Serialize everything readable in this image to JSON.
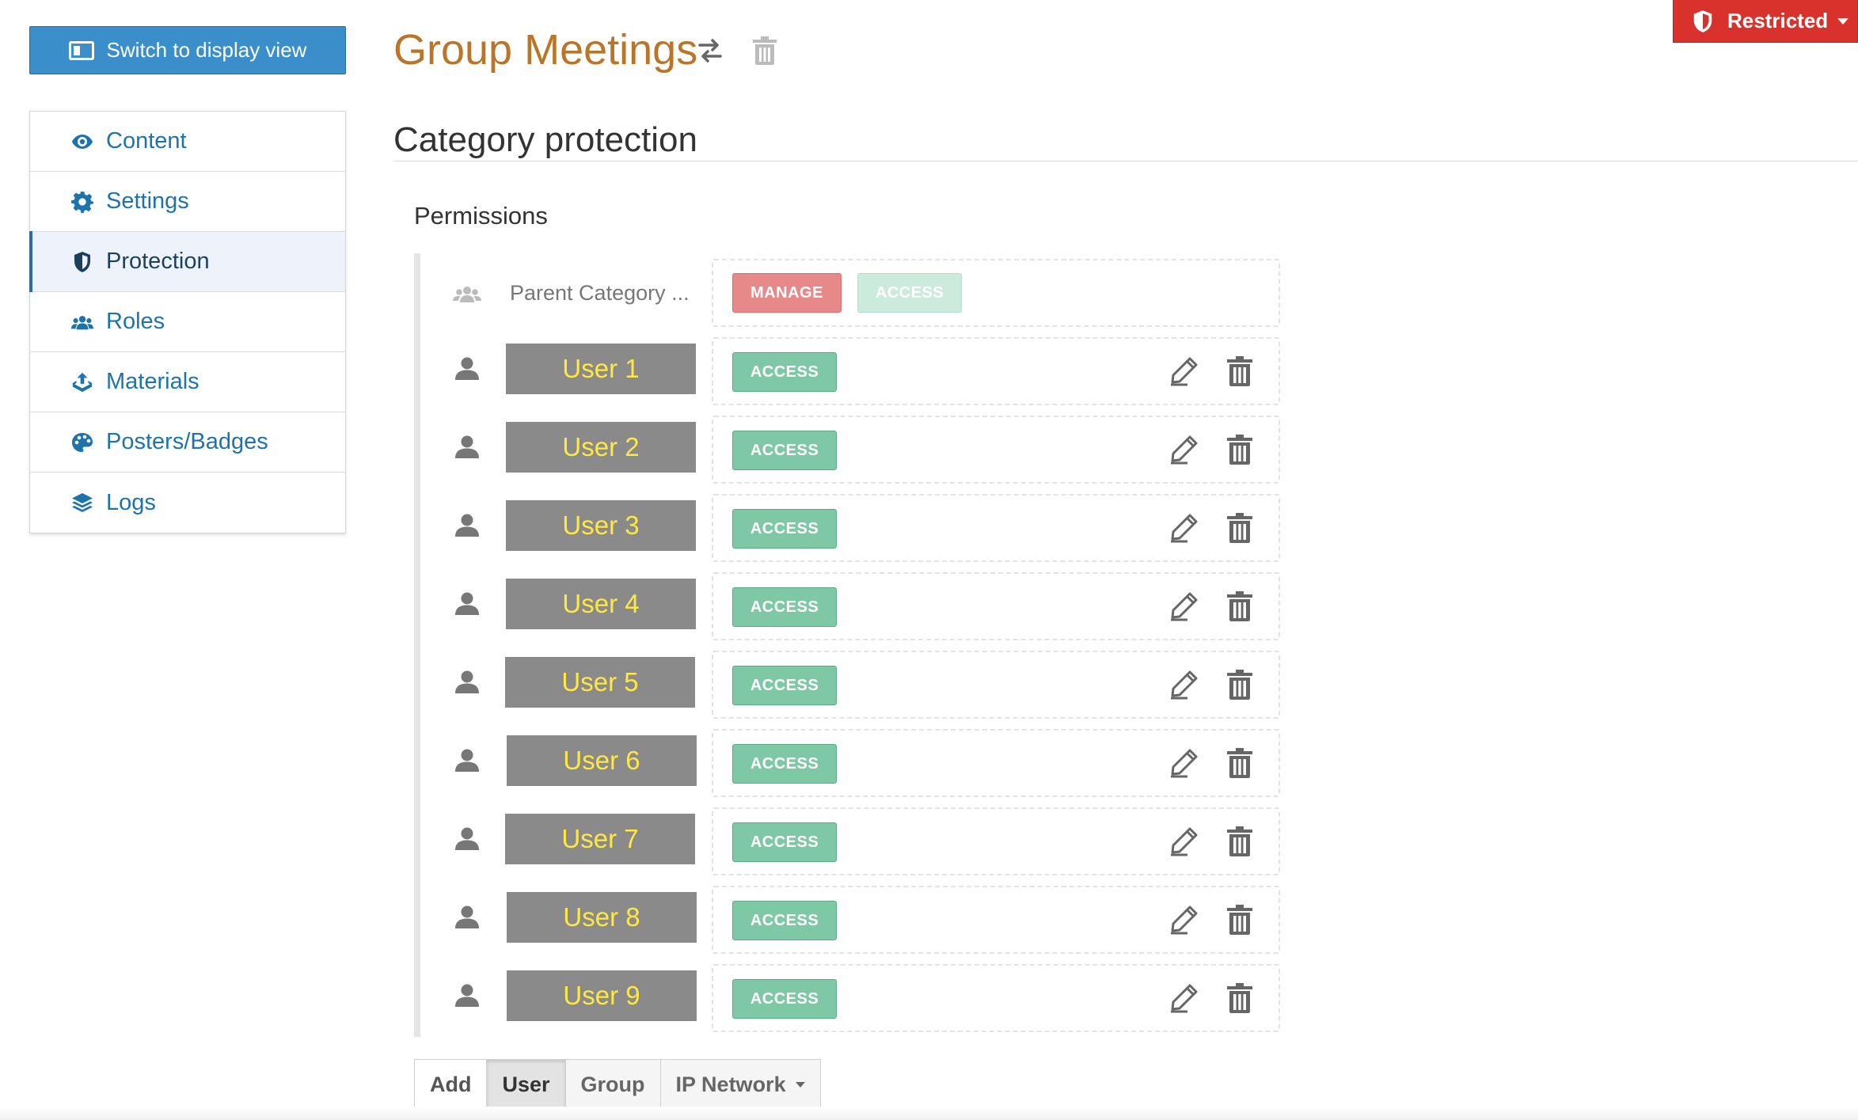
{
  "header": {
    "restricted_label": "Restricted",
    "switch_label": "Switch to display view",
    "title": "Group Meetings"
  },
  "sidebar": {
    "items": [
      {
        "label": "Content",
        "icon": "eye-icon"
      },
      {
        "label": "Settings",
        "icon": "gear-icon"
      },
      {
        "label": "Protection",
        "icon": "shield-icon",
        "active": true
      },
      {
        "label": "Roles",
        "icon": "users-icon"
      },
      {
        "label": "Materials",
        "icon": "upload-icon"
      },
      {
        "label": "Posters/Badges",
        "icon": "palette-icon"
      },
      {
        "label": "Logs",
        "icon": "layers-icon"
      }
    ]
  },
  "main": {
    "section_title": "Category protection",
    "permissions_label": "Permissions",
    "parent": {
      "name": "Parent Category ...",
      "manage_label": "MANAGE",
      "access_label": "ACCESS"
    },
    "entries": [
      {
        "name": "User 1",
        "permission": "ACCESS"
      },
      {
        "name": "User 2",
        "permission": "ACCESS"
      },
      {
        "name": "User 3",
        "permission": "ACCESS"
      },
      {
        "name": "User 4",
        "permission": "ACCESS"
      },
      {
        "name": "User 5",
        "permission": "ACCESS"
      },
      {
        "name": "User 6",
        "permission": "ACCESS"
      },
      {
        "name": "User 7",
        "permission": "ACCESS"
      },
      {
        "name": "User 8",
        "permission": "ACCESS"
      },
      {
        "name": "User 9",
        "permission": "ACCESS"
      }
    ]
  },
  "toolbar": {
    "add_label": "Add",
    "user_label": "User",
    "group_label": "Group",
    "ip_label": "IP Network"
  },
  "colors": {
    "title": "#b9762a",
    "primary": "#3a8fcb",
    "restricted": "#d9322d",
    "access": "#7fc8a6",
    "manage": "#e88989",
    "user_box": "#8a8a8a",
    "user_text": "#ffe842"
  }
}
